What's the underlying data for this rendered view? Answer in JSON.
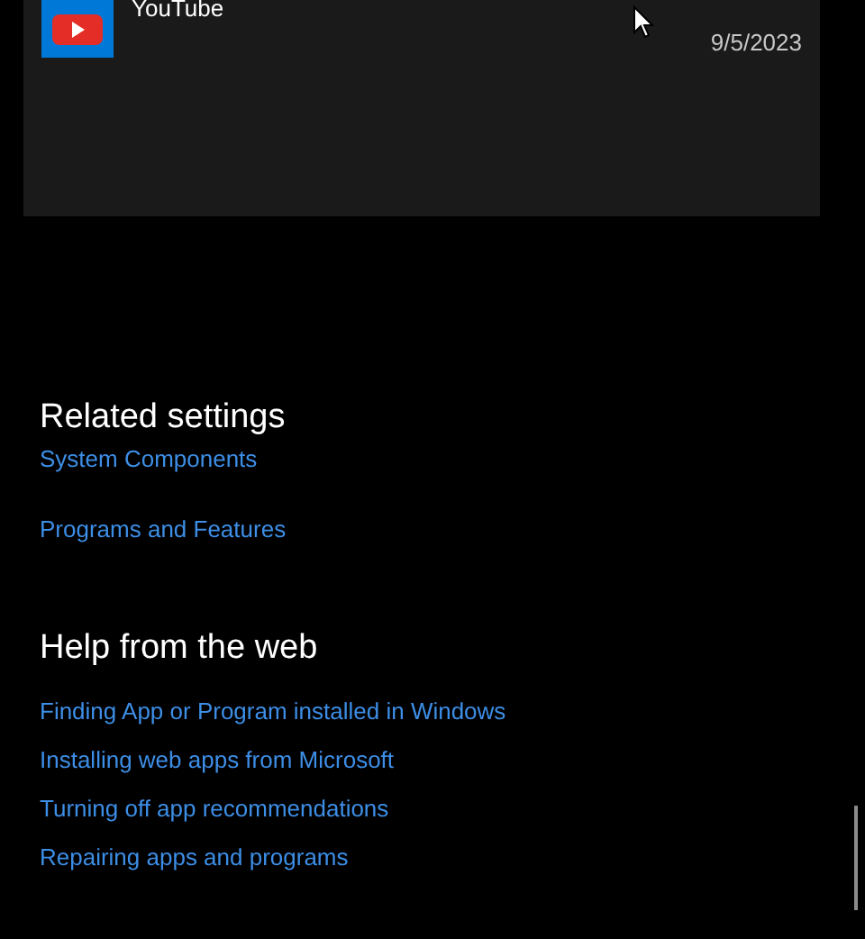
{
  "app_list": [
    {
      "name": "YouTube",
      "date": "9/5/2023"
    }
  ],
  "related_settings": {
    "title": "Related settings",
    "links": [
      "System Components",
      "Programs and Features"
    ]
  },
  "help_from_web": {
    "title": "Help from the web",
    "links": [
      "Finding App or Program installed in Windows",
      "Installing web apps from Microsoft",
      "Turning off app recommendations",
      "Repairing apps and programs"
    ]
  }
}
